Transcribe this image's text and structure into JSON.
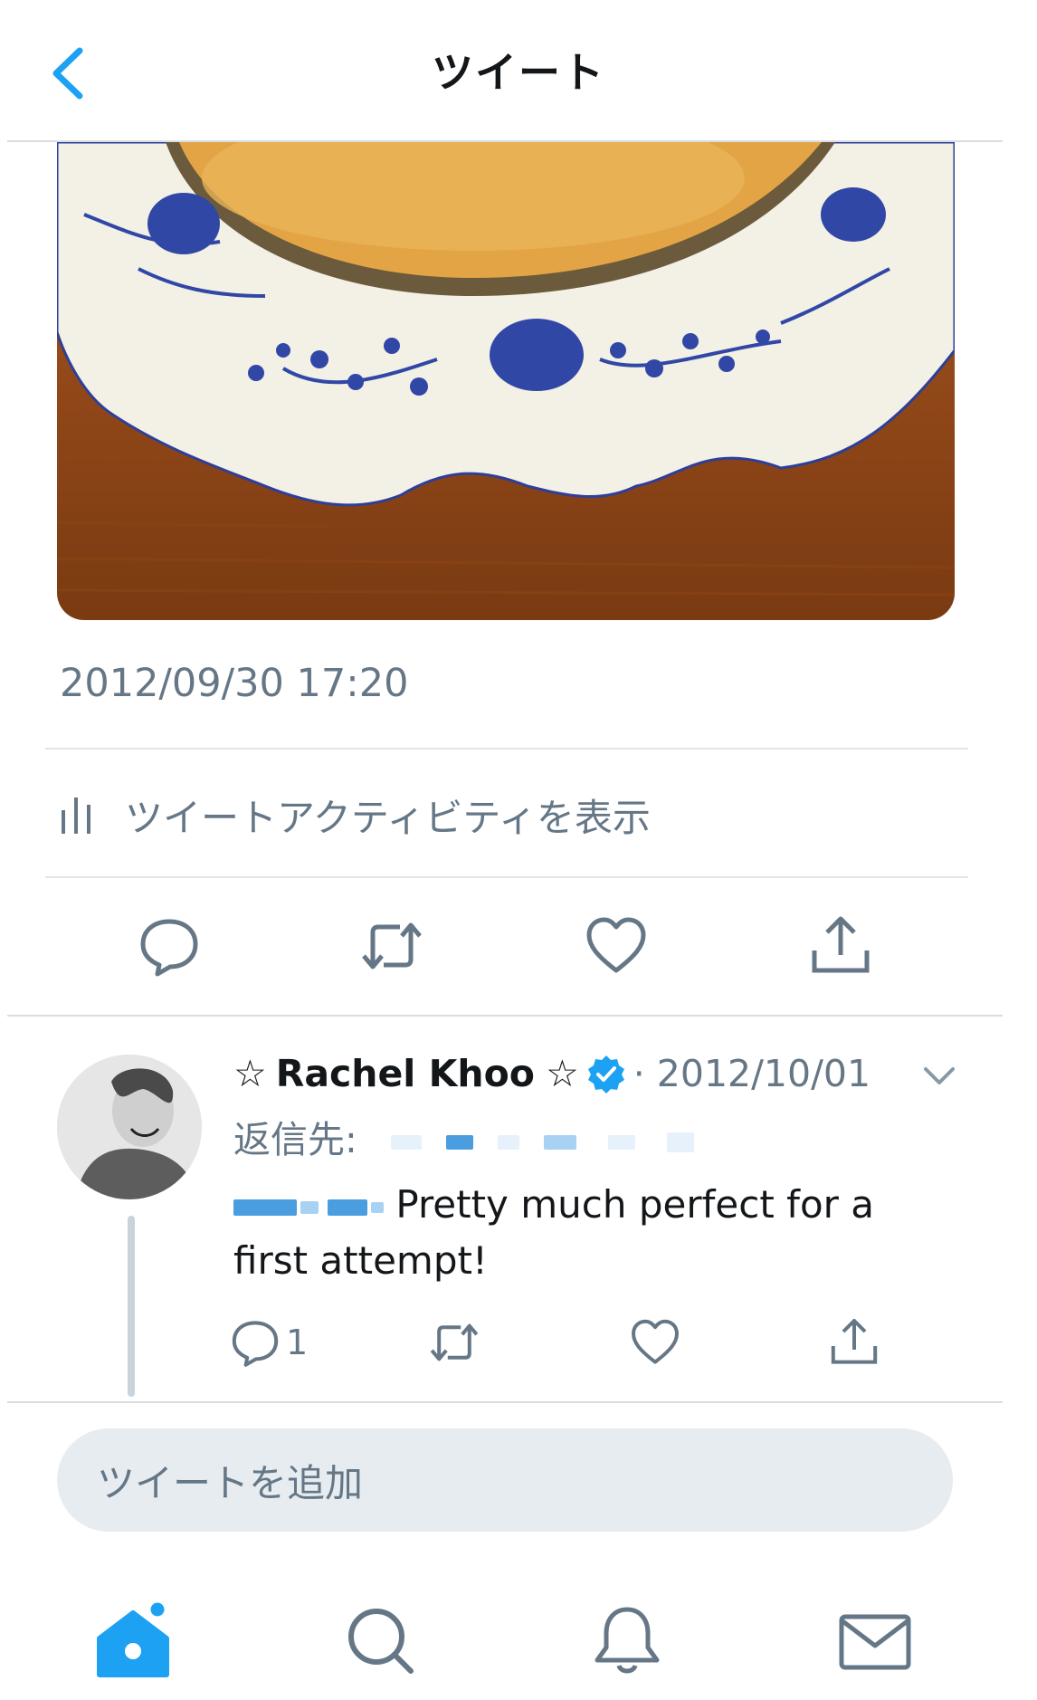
{
  "header": {
    "title": "ツイート",
    "back_icon": "chevron-left-icon"
  },
  "tweet": {
    "timestamp": "2012/09/30 17:20",
    "activity_label": "ツイートアクティビティを表示",
    "actions": [
      "reply-icon",
      "retweet-icon",
      "like-icon",
      "share-icon"
    ]
  },
  "reply": {
    "star_left": "☆",
    "name": "Rachel Khoo",
    "star_right": "☆",
    "date": "· 2012/10/01",
    "reply_to_label": "返信先:",
    "text": " Pretty much perfect for a first attempt!",
    "reply_count": "1"
  },
  "compose": {
    "placeholder": "ツイートを追加"
  },
  "tabbar": [
    "home-icon",
    "search-icon",
    "notifications-icon",
    "messages-icon"
  ],
  "colors": {
    "accent": "#1da1f2",
    "text": "#14171a",
    "muted": "#657786",
    "verified": "#1da1f2"
  }
}
